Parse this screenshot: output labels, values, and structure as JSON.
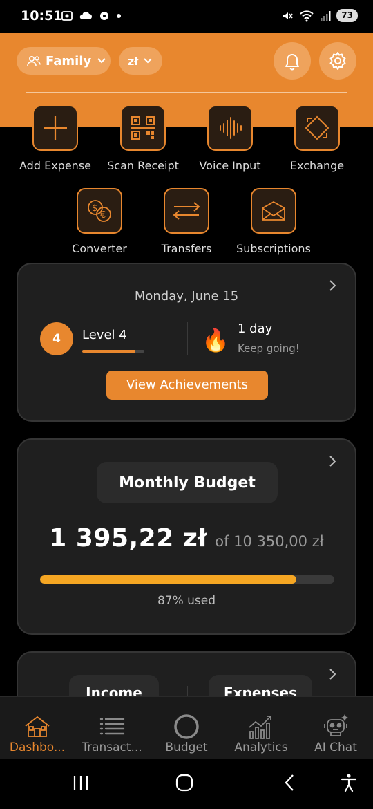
{
  "status_bar": {
    "time": "10:51",
    "battery": "73"
  },
  "header": {
    "account_selector": "Family",
    "currency_selector": "zł"
  },
  "quick_actions": [
    {
      "label": "Add Expense",
      "icon": "plus-icon"
    },
    {
      "label": "Scan Receipt",
      "icon": "qr-code-icon"
    },
    {
      "label": "Voice Input",
      "icon": "waveform-icon"
    },
    {
      "label": "Exchange",
      "icon": "exchange-icon"
    },
    {
      "label": "Converter",
      "icon": "currency-converter-icon"
    },
    {
      "label": "Transfers",
      "icon": "transfer-arrows-icon"
    },
    {
      "label": "Subscriptions",
      "icon": "envelope-icon"
    }
  ],
  "gamification": {
    "date": "Monday, June 15",
    "level_number": "4",
    "level_label": "Level 4",
    "level_progress": 0.85,
    "streak_days": "1 day",
    "streak_message": "Keep going!",
    "achievements_button": "View Achievements"
  },
  "budget": {
    "title": "Monthly Budget",
    "spent": "1 395,22 zł",
    "total": "of 10 350,00 zł",
    "used_fraction": 0.87,
    "used_label": "87% used"
  },
  "income_expenses": {
    "income_label": "Income",
    "expenses_label": "Expenses"
  },
  "bottom_nav": [
    {
      "label": "Dashbo...",
      "icon": "house-icon",
      "active": true
    },
    {
      "label": "Transact...",
      "icon": "list-icon",
      "active": false
    },
    {
      "label": "Budget",
      "icon": "ring-icon",
      "active": false
    },
    {
      "label": "Analytics",
      "icon": "chart-icon",
      "active": false
    },
    {
      "label": "AI Chat",
      "icon": "robot-icon",
      "active": false
    }
  ],
  "colors": {
    "accent": "#e8872e",
    "budget_bar": "#f5a623",
    "card_bg": "#1f1f1f"
  }
}
